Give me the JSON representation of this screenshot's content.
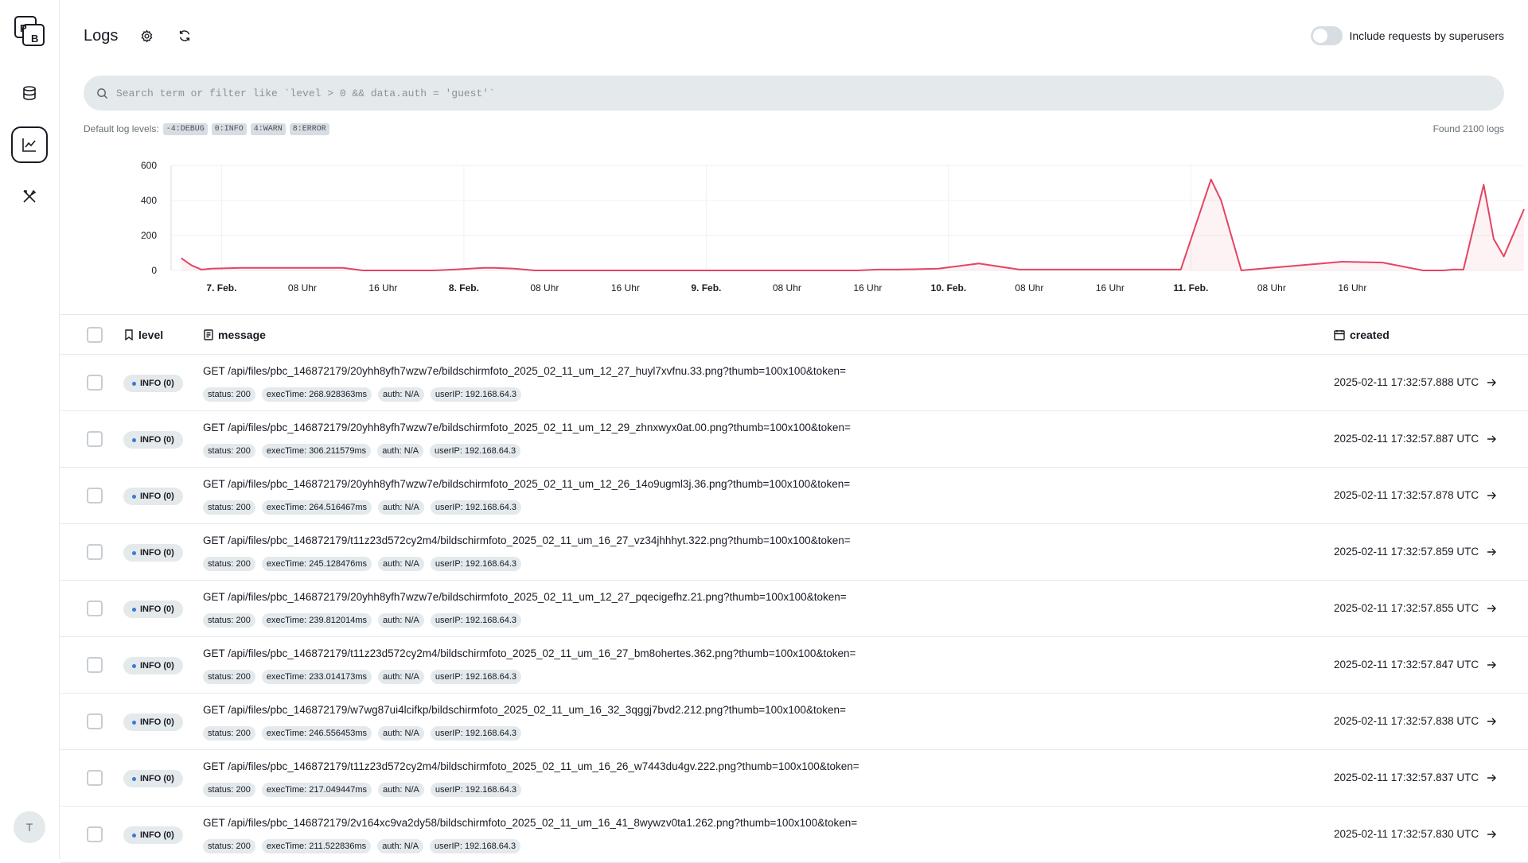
{
  "sidebar": {
    "logo_text": "PB",
    "avatar_initial": "T",
    "items": [
      {
        "name": "collections",
        "icon": "database-icon"
      },
      {
        "name": "logs",
        "icon": "chart-line-icon",
        "active": true
      },
      {
        "name": "settings",
        "icon": "tools-icon"
      }
    ]
  },
  "header": {
    "title": "Logs",
    "superusers_label": "Include requests by superusers"
  },
  "search": {
    "placeholder": "Search term or filter like `level > 0 && data.auth = 'guest'`"
  },
  "levels": {
    "label": "Default log levels:",
    "badges": [
      "-4:DEBUG",
      "0:INFO",
      "4:WARN",
      "8:ERROR"
    ],
    "found": "Found 2100 logs"
  },
  "colors": {
    "accent_line": "#e34562",
    "info_dot": "#3a7bd5"
  },
  "chart_data": {
    "type": "area",
    "y_ticks": [
      "0",
      "200",
      "400",
      "600"
    ],
    "ylim": [
      0,
      600
    ],
    "x_ticks": [
      "7. Feb.",
      "08 Uhr",
      "16 Uhr",
      "8. Feb.",
      "08 Uhr",
      "16 Uhr",
      "9. Feb.",
      "08 Uhr",
      "16 Uhr",
      "10. Feb.",
      "08 Uhr",
      "16 Uhr",
      "11. Feb.",
      "08 Uhr",
      "16 Uhr"
    ],
    "bold_ticks": [
      "7. Feb.",
      "8. Feb.",
      "9. Feb.",
      "10. Feb.",
      "11. Feb."
    ],
    "grid": true,
    "series": [
      {
        "x": [
          -3,
          -2,
          -1,
          0,
          3,
          8,
          12,
          13,
          15,
          18,
          22,
          24,
          27,
          28,
          30,
          32,
          34,
          38,
          42,
          46,
          50,
          54,
          58,
          60,
          62,
          64,
          66,
          68,
          72,
          76,
          80,
          84,
          88,
          92,
          96,
          99,
          100,
          102,
          104,
          108,
          112,
          116,
          120,
          122,
          123,
          124,
          126,
          127,
          128,
          130
        ],
        "y": [
          70,
          30,
          5,
          10,
          15,
          15,
          15,
          15,
          0,
          0,
          0,
          5,
          15,
          15,
          10,
          0,
          0,
          0,
          0,
          0,
          0,
          0,
          0,
          0,
          0,
          0,
          5,
          5,
          10,
          40,
          5,
          5,
          5,
          5,
          5,
          520,
          400,
          0,
          10,
          30,
          50,
          45,
          0,
          0,
          5,
          5,
          490,
          180,
          80,
          350
        ]
      }
    ]
  },
  "table": {
    "headers": {
      "level": "level",
      "message": "message",
      "created": "created"
    },
    "rows": [
      {
        "level": "INFO (0)",
        "message": "GET /api/files/pbc_146872179/20yhh8yfh7wzw7e/bildschirmfoto_2025_02_11_um_12_27_huyl7xvfnu.33.png?thumb=100x100&token=",
        "status": "status: 200",
        "exec": "execTime: 268.928363ms",
        "auth": "auth: N/A",
        "ip": "userIP: 192.168.64.3",
        "created": "2025-02-11 17:32:57.888 UTC"
      },
      {
        "level": "INFO (0)",
        "message": "GET /api/files/pbc_146872179/20yhh8yfh7wzw7e/bildschirmfoto_2025_02_11_um_12_29_zhnxwyx0at.00.png?thumb=100x100&token=",
        "status": "status: 200",
        "exec": "execTime: 306.211579ms",
        "auth": "auth: N/A",
        "ip": "userIP: 192.168.64.3",
        "created": "2025-02-11 17:32:57.887 UTC"
      },
      {
        "level": "INFO (0)",
        "message": "GET /api/files/pbc_146872179/20yhh8yfh7wzw7e/bildschirmfoto_2025_02_11_um_12_26_14o9ugml3j.36.png?thumb=100x100&token=",
        "status": "status: 200",
        "exec": "execTime: 264.516467ms",
        "auth": "auth: N/A",
        "ip": "userIP: 192.168.64.3",
        "created": "2025-02-11 17:32:57.878 UTC"
      },
      {
        "level": "INFO (0)",
        "message": "GET /api/files/pbc_146872179/t11z23d572cy2m4/bildschirmfoto_2025_02_11_um_16_27_vz34jhhhyt.322.png?thumb=100x100&token=",
        "status": "status: 200",
        "exec": "execTime: 245.128476ms",
        "auth": "auth: N/A",
        "ip": "userIP: 192.168.64.3",
        "created": "2025-02-11 17:32:57.859 UTC"
      },
      {
        "level": "INFO (0)",
        "message": "GET /api/files/pbc_146872179/20yhh8yfh7wzw7e/bildschirmfoto_2025_02_11_um_12_27_pqecigefhz.21.png?thumb=100x100&token=",
        "status": "status: 200",
        "exec": "execTime: 239.812014ms",
        "auth": "auth: N/A",
        "ip": "userIP: 192.168.64.3",
        "created": "2025-02-11 17:32:57.855 UTC"
      },
      {
        "level": "INFO (0)",
        "message": "GET /api/files/pbc_146872179/t11z23d572cy2m4/bildschirmfoto_2025_02_11_um_16_27_bm8ohertes.362.png?thumb=100x100&token=",
        "status": "status: 200",
        "exec": "execTime: 233.014173ms",
        "auth": "auth: N/A",
        "ip": "userIP: 192.168.64.3",
        "created": "2025-02-11 17:32:57.847 UTC"
      },
      {
        "level": "INFO (0)",
        "message": "GET /api/files/pbc_146872179/w7wg87ui4lcifkp/bildschirmfoto_2025_02_11_um_16_32_3qggj7bvd2.212.png?thumb=100x100&token=",
        "status": "status: 200",
        "exec": "execTime: 246.556453ms",
        "auth": "auth: N/A",
        "ip": "userIP: 192.168.64.3",
        "created": "2025-02-11 17:32:57.838 UTC"
      },
      {
        "level": "INFO (0)",
        "message": "GET /api/files/pbc_146872179/t11z23d572cy2m4/bildschirmfoto_2025_02_11_um_16_26_w7443du4gv.222.png?thumb=100x100&token=",
        "status": "status: 200",
        "exec": "execTime: 217.049447ms",
        "auth": "auth: N/A",
        "ip": "userIP: 192.168.64.3",
        "created": "2025-02-11 17:32:57.837 UTC"
      },
      {
        "level": "INFO (0)",
        "message": "GET /api/files/pbc_146872179/2v164xc9va2dy58/bildschirmfoto_2025_02_11_um_16_41_8wywzv0ta1.262.png?thumb=100x100&token=",
        "status": "status: 200",
        "exec": "execTime: 211.522836ms",
        "auth": "auth: N/A",
        "ip": "userIP: 192.168.64.3",
        "created": "2025-02-11 17:32:57.830 UTC"
      }
    ]
  }
}
